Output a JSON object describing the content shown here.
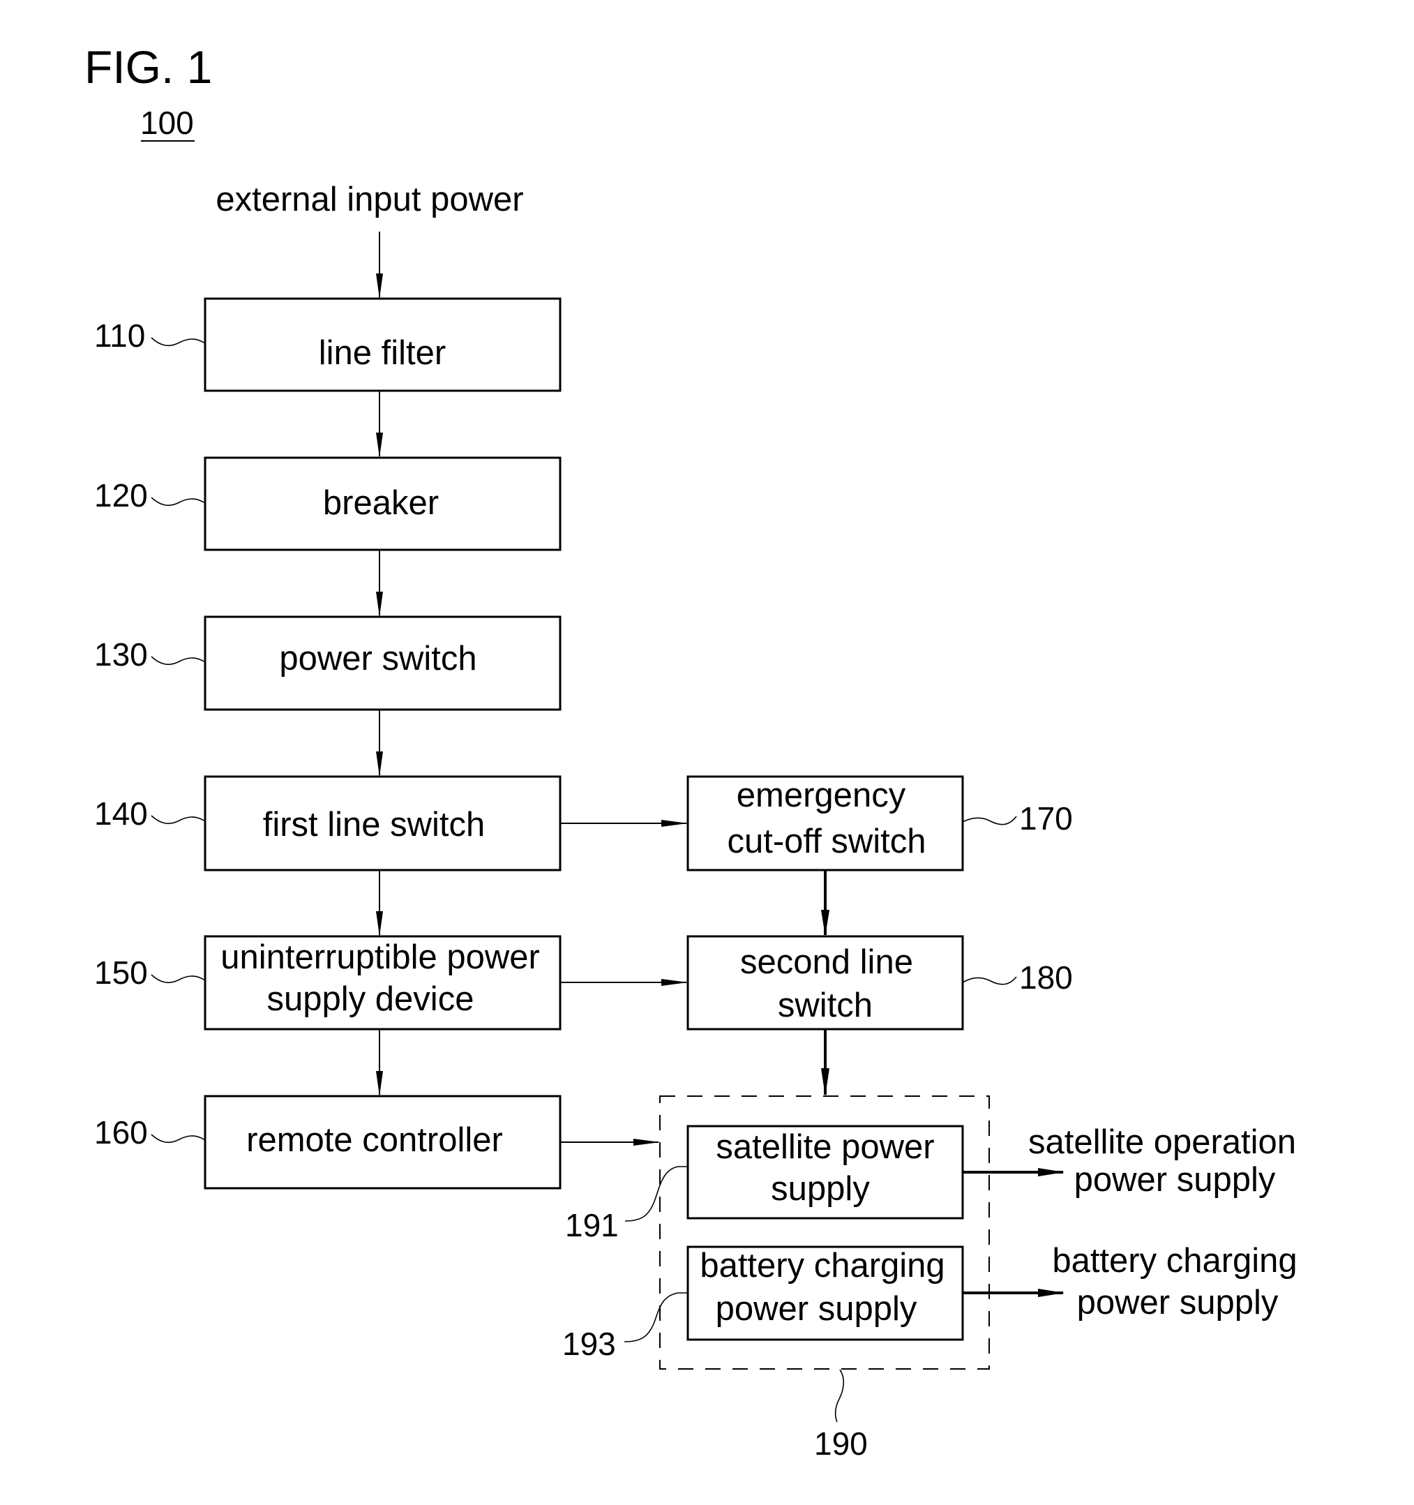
{
  "figure": {
    "title": "FIG. 1",
    "reference": "100"
  },
  "input": {
    "label": "external input power"
  },
  "blocks": [
    {
      "id": "line-filter",
      "ref": "110",
      "lines": [
        "line filter"
      ]
    },
    {
      "id": "breaker",
      "ref": "120",
      "lines": [
        "breaker"
      ]
    },
    {
      "id": "power-switch",
      "ref": "130",
      "lines": [
        "power switch"
      ]
    },
    {
      "id": "first-line-switch",
      "ref": "140",
      "lines": [
        "first line switch"
      ]
    },
    {
      "id": "ups",
      "ref": "150",
      "lines": [
        "uninterruptible power",
        "supply device"
      ]
    },
    {
      "id": "remote-controller",
      "ref": "160",
      "lines": [
        "remote controller"
      ]
    },
    {
      "id": "emergency-cutoff-switch",
      "ref": "170",
      "lines": [
        "emergency",
        "cut-off switch"
      ]
    },
    {
      "id": "second-line-switch",
      "ref": "180",
      "lines": [
        "second line",
        "switch"
      ]
    },
    {
      "id": "satellite-power-supply",
      "ref": "191",
      "lines": [
        "satellite power",
        "supply"
      ]
    },
    {
      "id": "battery-charging-power-supply",
      "ref": "193",
      "lines": [
        "battery charging",
        "power supply"
      ]
    }
  ],
  "group": {
    "ref": "190"
  },
  "outputs": [
    {
      "id": "satellite-operation-output",
      "lines": [
        "satellite operation",
        "power supply"
      ]
    },
    {
      "id": "battery-charging-output",
      "lines": [
        "battery charging",
        "power supply"
      ]
    }
  ],
  "connections": [
    {
      "from": "external input power",
      "to": "line filter"
    },
    {
      "from": "line filter",
      "to": "breaker"
    },
    {
      "from": "breaker",
      "to": "power switch"
    },
    {
      "from": "power switch",
      "to": "first line switch"
    },
    {
      "from": "first line switch",
      "to": "uninterruptible power supply device"
    },
    {
      "from": "first line switch",
      "to": "emergency cut-off switch"
    },
    {
      "from": "uninterruptible power supply device",
      "to": "remote controller"
    },
    {
      "from": "uninterruptible power supply device",
      "to": "second line switch"
    },
    {
      "from": "emergency cut-off switch",
      "to": "second line switch"
    },
    {
      "from": "second line switch",
      "to": "190"
    },
    {
      "from": "remote controller",
      "to": "190"
    },
    {
      "from": "satellite power supply",
      "to": "satellite operation power supply"
    },
    {
      "from": "battery charging power supply",
      "to": "battery charging power supply output"
    }
  ]
}
